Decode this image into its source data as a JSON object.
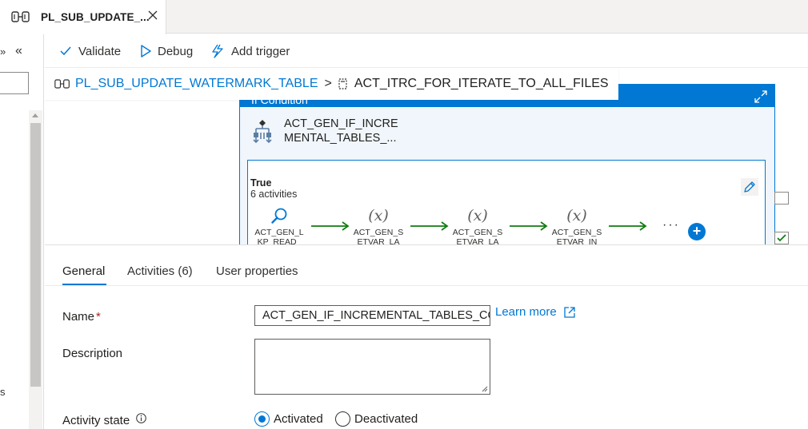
{
  "tab": {
    "title": "PL_SUB_UPDATE_..."
  },
  "toolbar": {
    "validate": "Validate",
    "debug": "Debug",
    "add_trigger": "Add trigger"
  },
  "breadcrumb": {
    "pipeline": "PL_SUB_UPDATE_WATERMARK_TABLE",
    "separator": ">",
    "activity": "ACT_ITRC_FOR_ITERATE_TO_ALL_FILES"
  },
  "if_condition": {
    "header": "If Condition",
    "activity_name_line1": "ACT_GEN_IF_INCRE",
    "activity_name_line2": "MENTAL_TABLES_...",
    "true_branch": {
      "label": "True",
      "count": "6 activities",
      "steps": [
        {
          "icon": "lookup-icon",
          "line1": "ACT_GEN_L",
          "line2": "KP_READ_"
        },
        {
          "icon": "variable-icon",
          "symbol": "(x)",
          "line1": "ACT_GEN_S",
          "line2": "ETVAR_LA"
        },
        {
          "icon": "variable-icon",
          "symbol": "(x)",
          "line1": "ACT_GEN_S",
          "line2": "ETVAR_LA"
        },
        {
          "icon": "variable-icon",
          "symbol": "(x)",
          "line1": "ACT_GEN_S",
          "line2": "ETVAR_IN"
        }
      ],
      "more": "···",
      "add": "+"
    }
  },
  "properties": {
    "tabs": [
      "General",
      "Activities (6)",
      "User properties"
    ],
    "name_label": "Name",
    "required_mark": "*",
    "name_value": "ACT_GEN_IF_INCREMENTAL_TABLES_COL...",
    "learn_more": "Learn more",
    "description_label": "Description",
    "activity_state_label": "Activity state",
    "activated": "Activated",
    "deactivated": "Deactivated"
  },
  "left_pane": {
    "expand": "»",
    "collapse": "«",
    "ghost": "s"
  },
  "colors": {
    "accent": "#0078d4",
    "activity_bg": "#f0f6fc",
    "arrow": "#107c10"
  }
}
